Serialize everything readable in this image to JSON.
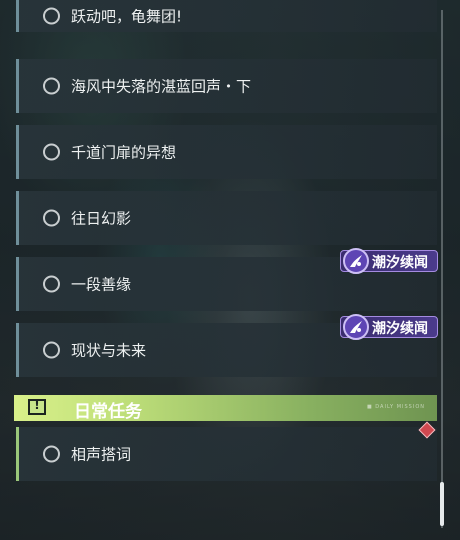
{
  "quests": [
    {
      "title": "跃动吧，龟舞团!"
    },
    {
      "title": "海风中失落的湛蓝回声・下"
    },
    {
      "title": "千道门扉的异想"
    },
    {
      "title": "往日幻影"
    },
    {
      "title": "一段善缘"
    },
    {
      "title": "现状与未来"
    }
  ],
  "tags": {
    "label": "潮汐续闻",
    "icon": "tide-emblem-icon"
  },
  "daily": {
    "section_title": "日常任务",
    "section_icon": "exclamation-icon",
    "decoration": "■ DAILY MISSION",
    "quests": [
      {
        "title": "相声搭词"
      }
    ]
  },
  "colors": {
    "tag_bg": "#4b3b8c",
    "daily_accent": "#c0e07a",
    "alert_diamond": "#d04850"
  }
}
